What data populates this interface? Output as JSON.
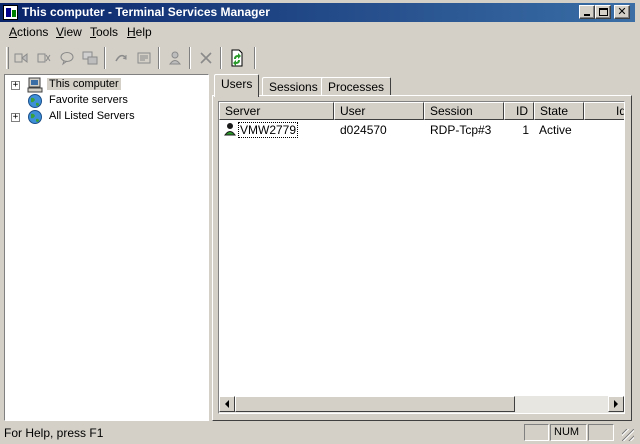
{
  "window": {
    "title": "This computer - Terminal Services Manager"
  },
  "menu": [
    {
      "label_u": "A",
      "label_rest": "ctions"
    },
    {
      "label_u": "V",
      "label_rest": "iew"
    },
    {
      "label_u": "T",
      "label_rest": "ools"
    },
    {
      "label_u": "H",
      "label_rest": "elp"
    }
  ],
  "toolbar": {
    "buttons": [
      "connect-icon",
      "disconnect-icon",
      "send-message-icon",
      "remote-control-icon",
      "reset-icon",
      "status-icon",
      "logoff-icon",
      "end-process-icon",
      "refresh-icon"
    ]
  },
  "tree": {
    "items": [
      {
        "label": "This computer",
        "expander": "+",
        "icon": "computer-icon",
        "selected": true
      },
      {
        "label": "Favorite servers",
        "expander": "",
        "icon": "globe-icon",
        "selected": false
      },
      {
        "label": "All Listed Servers",
        "expander": "+",
        "icon": "globe-icon",
        "selected": false
      }
    ]
  },
  "tabs": {
    "items": [
      "Users",
      "Sessions",
      "Processes"
    ],
    "active": "Users"
  },
  "users_table": {
    "columns": [
      "Server",
      "User",
      "Session",
      "ID",
      "State",
      "Id"
    ],
    "rows": [
      {
        "server": "VMW2779",
        "user": "d024570",
        "session": "RDP-Tcp#3",
        "id": "1",
        "state": "Active"
      }
    ]
  },
  "statusbar": {
    "help_text": "For Help, press F1",
    "num": "NUM"
  },
  "colors": {
    "titlebar_start": "#0a246a",
    "titlebar_end": "#3a6ea5",
    "face": "#d4d0c8"
  }
}
